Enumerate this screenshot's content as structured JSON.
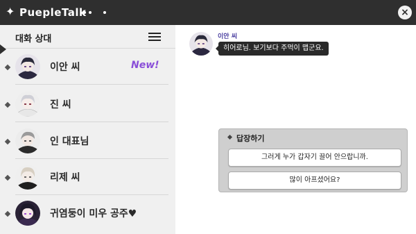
{
  "app": {
    "title": "PuepleTalk",
    "close_label": "×"
  },
  "sidebar": {
    "title": "대화 상대",
    "contacts": [
      {
        "name": "이안 씨",
        "badge": "New!"
      },
      {
        "name": "진 씨"
      },
      {
        "name": "인 대표님"
      },
      {
        "name": "리제 씨"
      },
      {
        "name": "귀염둥이 미우 공주♥"
      }
    ]
  },
  "chat": {
    "messages": [
      {
        "sender": "이안 씨",
        "text": "히어로님. 보기보다 주먹이 맵군요."
      }
    ]
  },
  "reply": {
    "title": "답장하기",
    "options": [
      "그러게 누가 갑자기 끌어 안으랍니까.",
      "많이 아프셨어요?"
    ]
  },
  "colors": {
    "titlebar": "#2f2f2f",
    "accent_new": "#8a4fd8",
    "bubble": "#2a2a2a"
  }
}
